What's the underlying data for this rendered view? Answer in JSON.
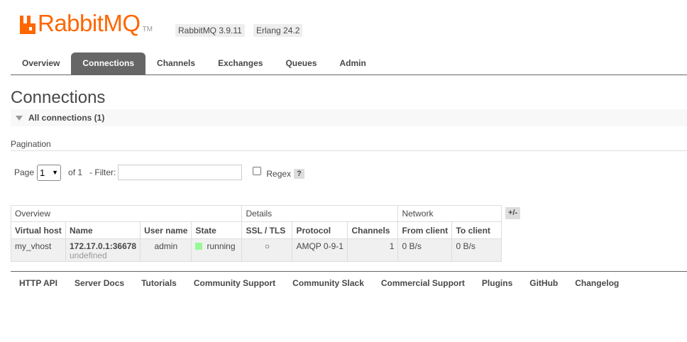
{
  "header": {
    "logo_text": "RabbitMQ",
    "trademark": "TM",
    "version": "RabbitMQ 3.9.11",
    "erlang": "Erlang 24.2",
    "brand_color": "#ff6600"
  },
  "tabs": [
    {
      "label": "Overview",
      "active": false
    },
    {
      "label": "Connections",
      "active": true
    },
    {
      "label": "Channels",
      "active": false
    },
    {
      "label": "Exchanges",
      "active": false
    },
    {
      "label": "Queues",
      "active": false
    },
    {
      "label": "Admin",
      "active": false
    }
  ],
  "page": {
    "title": "Connections",
    "section": "All connections (1)"
  },
  "pagination": {
    "label": "Pagination",
    "page_label": "Page",
    "page_value": "1",
    "of_label": "of 1",
    "filter_label": "- Filter:",
    "filter_value": "",
    "regex_label": "Regex",
    "regex_checked": false,
    "help": "?"
  },
  "table": {
    "groups": [
      "Overview",
      "Details",
      "Network"
    ],
    "columns": [
      "Virtual host",
      "Name",
      "User name",
      "State",
      "SSL / TLS",
      "Protocol",
      "Channels",
      "From client",
      "To client"
    ],
    "rows": [
      {
        "vhost": "my_vhost",
        "name": "172.17.0.1:36678",
        "name_sub": "undefined",
        "user": "admin",
        "state": "running",
        "state_color": "#98f898",
        "ssl": "○",
        "protocol": "AMQP 0-9-1",
        "channels": "1",
        "from_client": "0 B/s",
        "to_client": "0 B/s"
      }
    ],
    "toggle": "+/-"
  },
  "footer": [
    "HTTP API",
    "Server Docs",
    "Tutorials",
    "Community Support",
    "Community Slack",
    "Commercial Support",
    "Plugins",
    "GitHub",
    "Changelog"
  ]
}
